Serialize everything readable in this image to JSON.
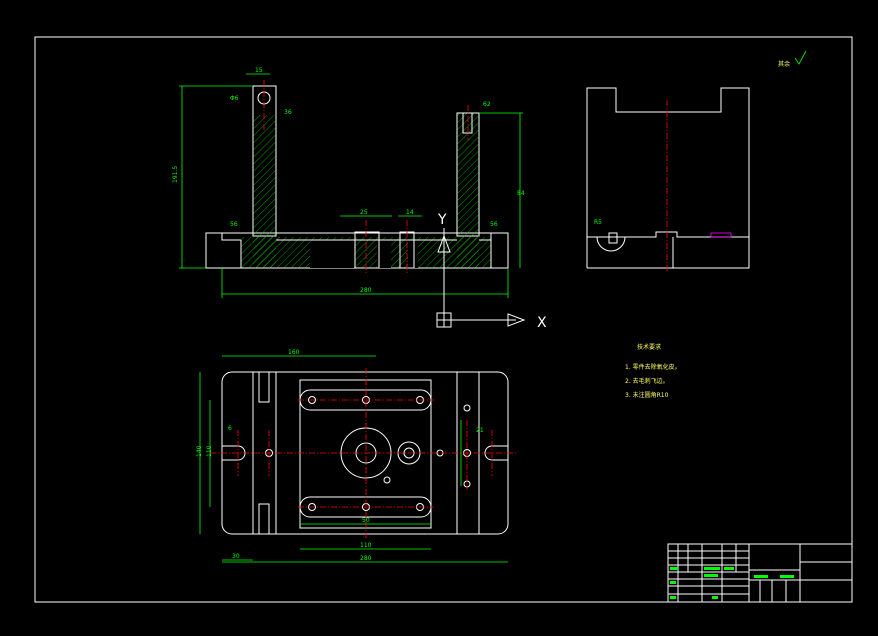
{
  "colors": {
    "background": "#000000",
    "outline": "#ffffff",
    "dimension": "#00ff00",
    "centerline": "#ff0000",
    "hatch": "#00ff00",
    "note_text": "#ffff66"
  },
  "roughness_mark": "其余",
  "axis_labels": {
    "y": "Y",
    "x": "X"
  },
  "tech_requirements": {
    "title": "技术要求",
    "items": [
      "1. 零件去除氧化皮。",
      "2. 去毛刺飞边。",
      "3. 未注圆角R10"
    ]
  },
  "front_view": {
    "overall_width": "280",
    "total_height": "191.5",
    "side_height": "84",
    "dims": [
      "25",
      "62",
      "56",
      "36",
      "14",
      "Φ6",
      "15"
    ]
  },
  "plan_view": {
    "overall_width_top": "160",
    "overall_width_bottom": "280",
    "center_width": "110",
    "height_left": "140",
    "height_left_inner": "110",
    "bottom_dims": [
      "30",
      "50"
    ],
    "slot_dims": [
      "21",
      "6"
    ]
  }
}
